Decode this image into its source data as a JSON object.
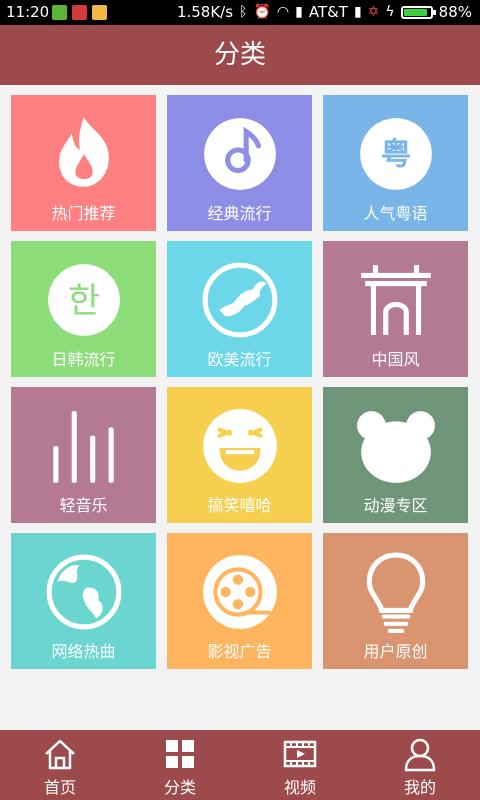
{
  "status_bar": {
    "time": "11:20",
    "speed": "1.58K/s",
    "carrier": "AT&T",
    "battery": "88%",
    "battery_level": 0.88
  },
  "header": {
    "title": "分类"
  },
  "categories": [
    {
      "label": "热门推荐",
      "icon": "flame-icon",
      "color": "#ff8080"
    },
    {
      "label": "经典流行",
      "icon": "music-disc-icon",
      "color": "#8f8ee6"
    },
    {
      "label": "人气粤语",
      "icon": "cantonese-icon",
      "color": "#79b5e9"
    },
    {
      "label": "日韩流行",
      "icon": "korean-char-icon",
      "color": "#8cdc7a"
    },
    {
      "label": "欧美流行",
      "icon": "globe-world-icon",
      "color": "#6cd7e8"
    },
    {
      "label": "中国风",
      "icon": "chinese-gate-icon",
      "color": "#b47a93"
    },
    {
      "label": "轻音乐",
      "icon": "sound-bars-icon",
      "color": "#b47a93"
    },
    {
      "label": "搞笑嘻哈",
      "icon": "laughing-face-icon",
      "color": "#f7cf4f"
    },
    {
      "label": "动漫专区",
      "icon": "bear-head-icon",
      "color": "#6f9678"
    },
    {
      "label": "网络热曲",
      "icon": "internet-globe-icon",
      "color": "#6ad6cf"
    },
    {
      "label": "影视广告",
      "icon": "film-reel-icon",
      "color": "#ffb55f"
    },
    {
      "label": "用户原创",
      "icon": "lightbulb-icon",
      "color": "#d99470"
    }
  ],
  "icon_glyphs": {
    "cantonese": "粤",
    "korean": "한"
  },
  "bottom_nav": [
    {
      "label": "首页",
      "icon": "home-icon"
    },
    {
      "label": "分类",
      "icon": "category-grid-icon"
    },
    {
      "label": "视频",
      "icon": "video-icon"
    },
    {
      "label": "我的",
      "icon": "profile-icon"
    }
  ],
  "colors": {
    "header_bg": "#9d4a4d",
    "page_bg": "#f3f3f3",
    "status_bg": "#000000"
  }
}
